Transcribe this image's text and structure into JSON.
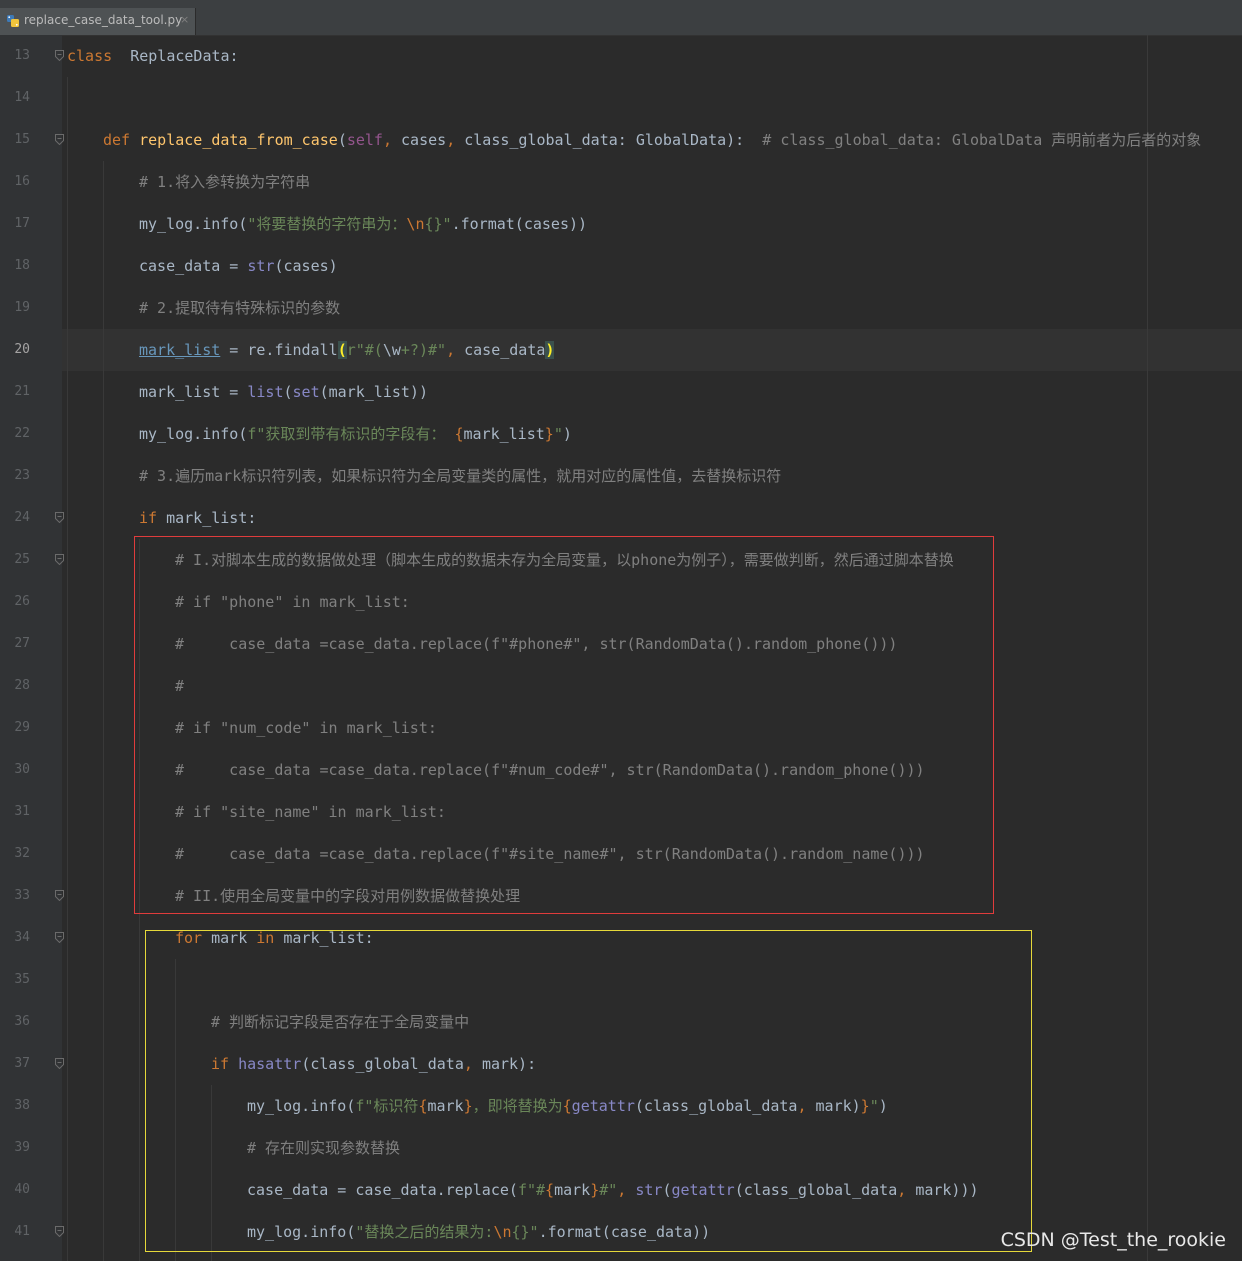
{
  "editor": {
    "tab": {
      "filename": "replace_case_data_tool.py",
      "close": "×"
    },
    "lines": [
      {
        "n": "13",
        "tokens": [
          [
            "kw",
            "class"
          ],
          [
            "",
            "  ReplaceData:"
          ]
        ]
      },
      {
        "n": "14",
        "tokens": []
      },
      {
        "n": "15",
        "tokens": [
          [
            "kw",
            "def "
          ],
          [
            "fn",
            "replace_data_from_case"
          ],
          [
            "",
            "("
          ],
          [
            "sf",
            "self"
          ],
          [
            "kw",
            ", "
          ],
          [
            "",
            "cases"
          ],
          [
            "kw",
            ", "
          ],
          [
            "",
            "class_global_data: GlobalData):  "
          ],
          [
            "cm",
            "# class_global_data: GlobalData 声明前者为后者的对象"
          ]
        ]
      },
      {
        "n": "16",
        "tokens": [
          [
            "cm",
            "# 1.将入参转换为字符串"
          ]
        ]
      },
      {
        "n": "17",
        "tokens": [
          [
            "",
            "my_log.info("
          ],
          [
            "str",
            "\"将要替换的字符串为："
          ],
          [
            "esc",
            "\\n"
          ],
          [
            "str",
            "{}\""
          ],
          [
            "",
            ".format(cases))"
          ]
        ]
      },
      {
        "n": "18",
        "tokens": [
          [
            "",
            "case_data = "
          ],
          [
            "bi",
            "str"
          ],
          [
            "",
            "(cases)"
          ]
        ]
      },
      {
        "n": "19",
        "tokens": [
          [
            "cm",
            "# 2.提取待有特殊标识的参数"
          ]
        ]
      },
      {
        "n": "20",
        "tokens": [
          [
            "ul",
            "mark_list"
          ],
          [
            "",
            " = re.findall"
          ],
          [
            "brk",
            "("
          ],
          [
            "str",
            "r\"#("
          ],
          [
            "",
            "\\w"
          ],
          [
            "str",
            "+?)#\""
          ],
          [
            "kw",
            ", "
          ],
          [
            "",
            "case_data"
          ],
          [
            "brk",
            ")"
          ]
        ]
      },
      {
        "n": "21",
        "tokens": [
          [
            "",
            "mark_list = "
          ],
          [
            "bi",
            "list"
          ],
          [
            "",
            "("
          ],
          [
            "bi",
            "set"
          ],
          [
            "",
            "(mark_list))"
          ]
        ]
      },
      {
        "n": "22",
        "tokens": [
          [
            "",
            "my_log.info("
          ],
          [
            "str",
            "f\"获取到带有标识的字段有： "
          ],
          [
            "esc",
            "{"
          ],
          [
            "",
            "mark_list"
          ],
          [
            "esc",
            "}"
          ],
          [
            "str",
            "\""
          ],
          [
            "",
            ")"
          ]
        ]
      },
      {
        "n": "23",
        "tokens": [
          [
            "cm",
            "# 3.遍历mark标识符列表，如果标识符为全局变量类的属性，就用对应的属性值，去替换标识符"
          ]
        ]
      },
      {
        "n": "24",
        "tokens": [
          [
            "kw",
            "if "
          ],
          [
            "",
            "mark_list:"
          ]
        ]
      },
      {
        "n": "25",
        "tokens": [
          [
            "cm",
            "# I.对脚本生成的数据做处理（脚本生成的数据未存为全局变量，以phone为例子），需要做判断，然后通过脚本替换"
          ]
        ]
      },
      {
        "n": "26",
        "tokens": [
          [
            "cm",
            "# if \"phone\" in mark_list:"
          ]
        ]
      },
      {
        "n": "27",
        "tokens": [
          [
            "cm",
            "#     case_data =case_data.replace(f\"#phone#\", str(RandomData().random_phone()))"
          ]
        ]
      },
      {
        "n": "28",
        "tokens": [
          [
            "cm",
            "#"
          ]
        ]
      },
      {
        "n": "29",
        "tokens": [
          [
            "cm",
            "# if \"num_code\" in mark_list:"
          ]
        ]
      },
      {
        "n": "30",
        "tokens": [
          [
            "cm",
            "#     case_data =case_data.replace(f\"#num_code#\", str(RandomData().random_phone()))"
          ]
        ]
      },
      {
        "n": "31",
        "tokens": [
          [
            "cm",
            "# if \"site_name\" in mark_list:"
          ]
        ]
      },
      {
        "n": "32",
        "tokens": [
          [
            "cm",
            "#     case_data =case_data.replace(f\"#site_name#\", str(RandomData().random_name()))"
          ]
        ]
      },
      {
        "n": "33",
        "tokens": [
          [
            "cm",
            "# II.使用全局变量中的字段对用例数据做替换处理"
          ]
        ]
      },
      {
        "n": "34",
        "tokens": [
          [
            "kw",
            "for "
          ],
          [
            "",
            "mark "
          ],
          [
            "kw",
            "in "
          ],
          [
            "",
            "mark_list:"
          ]
        ]
      },
      {
        "n": "35",
        "tokens": []
      },
      {
        "n": "36",
        "tokens": [
          [
            "cm",
            "# 判断标记字段是否存在于全局变量中"
          ]
        ]
      },
      {
        "n": "37",
        "tokens": [
          [
            "kw",
            "if "
          ],
          [
            "bi",
            "hasattr"
          ],
          [
            "",
            "(class_global_data"
          ],
          [
            "kw",
            ", "
          ],
          [
            "",
            "mark):"
          ]
        ]
      },
      {
        "n": "38",
        "tokens": [
          [
            "",
            "my_log.info("
          ],
          [
            "str",
            "f\"标识符"
          ],
          [
            "esc",
            "{"
          ],
          [
            "",
            "mark"
          ],
          [
            "esc",
            "}"
          ],
          [
            "str",
            "，即将替换为"
          ],
          [
            "esc",
            "{"
          ],
          [
            "bi",
            "getattr"
          ],
          [
            "",
            "(class_global_data"
          ],
          [
            "kw",
            ", "
          ],
          [
            "",
            "mark)"
          ],
          [
            "esc",
            "}"
          ],
          [
            "str",
            "\""
          ],
          [
            "",
            ")"
          ]
        ]
      },
      {
        "n": "39",
        "tokens": [
          [
            "cm",
            "# 存在则实现参数替换"
          ]
        ]
      },
      {
        "n": "40",
        "tokens": [
          [
            "",
            "case_data = case_data.replace("
          ],
          [
            "str",
            "f\"#"
          ],
          [
            "esc",
            "{"
          ],
          [
            "",
            "mark"
          ],
          [
            "esc",
            "}"
          ],
          [
            "str",
            "#\""
          ],
          [
            "kw",
            ", "
          ],
          [
            "bi",
            "str"
          ],
          [
            "",
            "("
          ],
          [
            "bi",
            "getattr"
          ],
          [
            "",
            "(class_global_data"
          ],
          [
            "kw",
            ", "
          ],
          [
            "",
            "mark)))"
          ]
        ]
      },
      {
        "n": "41",
        "tokens": [
          [
            "",
            "my_log.info("
          ],
          [
            "str",
            "\"替换之后的结果为:"
          ],
          [
            "esc",
            "\\n"
          ],
          [
            "str",
            "{}\""
          ],
          [
            "",
            ".format(case_data))"
          ]
        ]
      }
    ]
  },
  "watermark": "CSDN @Test_the_rookie"
}
